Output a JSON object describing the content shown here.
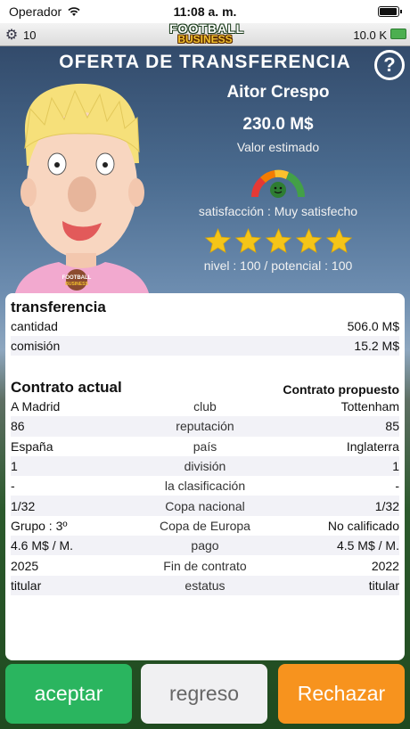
{
  "status_bar": {
    "carrier": "Operador",
    "time": "11:08 a. m.",
    "battery_level": 1.0
  },
  "game_bar": {
    "level": "10",
    "logo_top": "FOOTBALL",
    "logo_bottom": "BUSINESS",
    "money": "10.0 K"
  },
  "header": {
    "title": "OFERTA DE TRANSFERENCIA",
    "help_label": "?"
  },
  "player": {
    "name": "Aitor Crespo",
    "value": "230.0 M$",
    "value_label": "Valor estimado",
    "satisfaction": "satisfacción : Muy satisfecho",
    "stars": 5,
    "level_text": "nivel : 100 / potencial : 100",
    "shirt_logo_top": "FOOTBALL",
    "shirt_logo_bottom": "BUSINESS"
  },
  "transfer": {
    "title": "transferencia",
    "rows": [
      {
        "label": "cantidad",
        "value": "506.0 M$"
      },
      {
        "label": "comisión",
        "value": "15.2 M$"
      }
    ]
  },
  "contract": {
    "current_title": "Contrato actual",
    "proposed_title": "Contrato propuesto",
    "rows": [
      {
        "current": "A Madrid",
        "label": "club",
        "proposed": "Tottenham"
      },
      {
        "current": "86",
        "label": "reputación",
        "proposed": "85"
      },
      {
        "current": "España",
        "label": "país",
        "proposed": "Inglaterra"
      },
      {
        "current": "1",
        "label": "división",
        "proposed": "1"
      },
      {
        "current": "-",
        "label": "la clasificación",
        "proposed": "-"
      },
      {
        "current": "1/32",
        "label": "Copa nacional",
        "proposed": "1/32"
      },
      {
        "current": "Grupo : 3º",
        "label": "Copa de Europa",
        "proposed": "No calificado"
      },
      {
        "current": "4.6 M$ / M.",
        "label": "pago",
        "proposed": "4.5 M$ / M."
      },
      {
        "current": "2025",
        "label": "Fin de contrato",
        "proposed": "2022"
      },
      {
        "current": "titular",
        "label": "estatus",
        "proposed": "titular"
      }
    ]
  },
  "buttons": {
    "accept": "aceptar",
    "back": "regreso",
    "reject": "Rechazar"
  },
  "colors": {
    "accept": "#2ab55f",
    "reject": "#f7931e",
    "back": "#f0f0f2",
    "star": "#f5c518"
  }
}
